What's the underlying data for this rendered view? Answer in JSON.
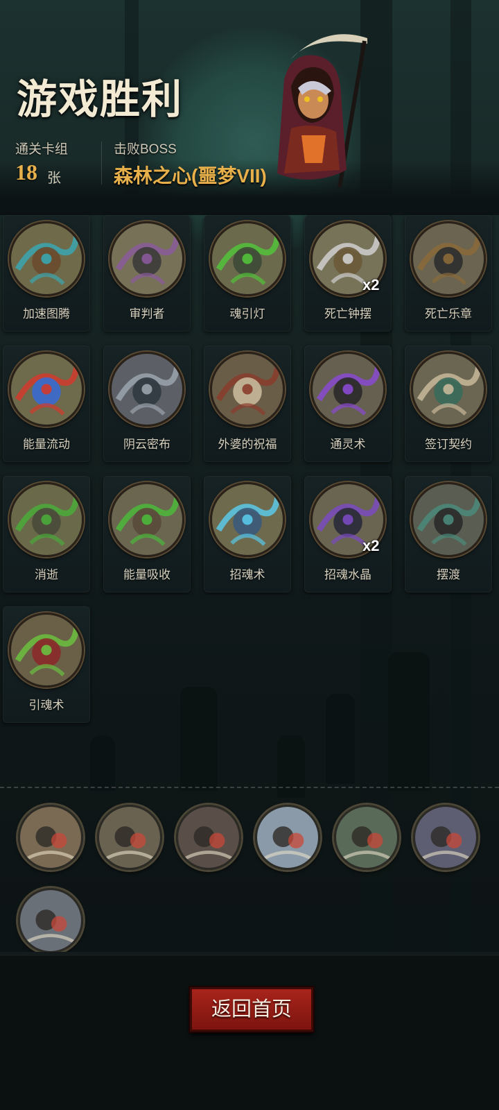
{
  "header": {
    "title": "游戏胜利",
    "deck_label": "通关卡组",
    "deck_count": "18",
    "deck_unit": "张",
    "boss_label": "击败BOSS",
    "boss_name": "森林之心(噩梦VII)"
  },
  "cards": [
    {
      "label": "加速图腾",
      "icon": "totem-clock-icon",
      "badge": ""
    },
    {
      "label": "审判者",
      "icon": "scythe-icon",
      "badge": ""
    },
    {
      "label": "魂引灯",
      "icon": "soul-lantern-icon",
      "badge": ""
    },
    {
      "label": "死亡钟摆",
      "icon": "death-pendulum-icon",
      "badge": "x2"
    },
    {
      "label": "死亡乐章",
      "icon": "music-box-skulls-icon",
      "badge": ""
    },
    {
      "label": "能量流动",
      "icon": "energy-flow-icon",
      "badge": ""
    },
    {
      "label": "阴云密布",
      "icon": "storm-cloud-icon",
      "badge": ""
    },
    {
      "label": "外婆的祝福",
      "icon": "grandma-blessing-icon",
      "badge": ""
    },
    {
      "label": "通灵术",
      "icon": "necromancy-icon",
      "badge": ""
    },
    {
      "label": "签订契约",
      "icon": "contract-icon",
      "badge": ""
    },
    {
      "label": "消逝",
      "icon": "fade-away-icon",
      "badge": ""
    },
    {
      "label": "能量吸收",
      "icon": "energy-absorb-icon",
      "badge": ""
    },
    {
      "label": "招魂术",
      "icon": "summon-souls-icon",
      "badge": ""
    },
    {
      "label": "招魂水晶",
      "icon": "soul-crystal-icon",
      "badge": "x2"
    },
    {
      "label": "摆渡",
      "icon": "ferry-boat-icon",
      "badge": ""
    },
    {
      "label": "引魂术",
      "icon": "guide-souls-icon",
      "badge": ""
    }
  ],
  "relics": [
    {
      "icon": "girls-party-relic-icon"
    },
    {
      "icon": "warrior-relic-icon"
    },
    {
      "icon": "vampire-relic-icon"
    },
    {
      "icon": "dagger-relic-icon"
    },
    {
      "icon": "ghost-chair-relic-icon"
    },
    {
      "icon": "playing-card-relic-icon"
    },
    {
      "icon": "witch-hat-relic-icon"
    }
  ],
  "footer": {
    "return_button": "返回首页"
  },
  "colors": {
    "accent_gold": "#e8b04b",
    "button_red": "#a7241b",
    "card_frame": "#5a4a33"
  }
}
